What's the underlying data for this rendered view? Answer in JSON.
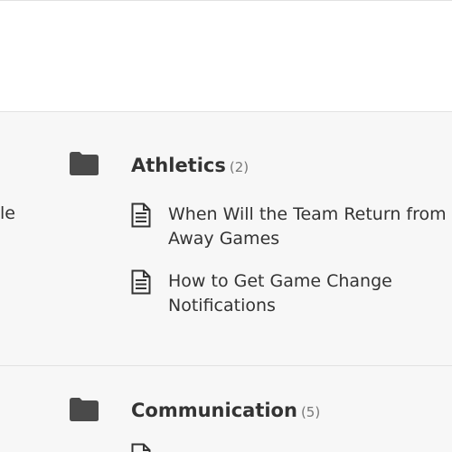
{
  "left_fragment": "le",
  "categories": [
    {
      "title": "Athletics",
      "count": "(2)",
      "articles": [
        "When Will the Team Return from Away Games",
        "How to Get Game Change Notifications"
      ]
    },
    {
      "title": "Communication",
      "count": "(5)",
      "articles": []
    }
  ],
  "colors": {
    "icon": "#4a4a4a",
    "text": "#333333",
    "muted": "#777777",
    "divider": "#e2e2e2"
  }
}
